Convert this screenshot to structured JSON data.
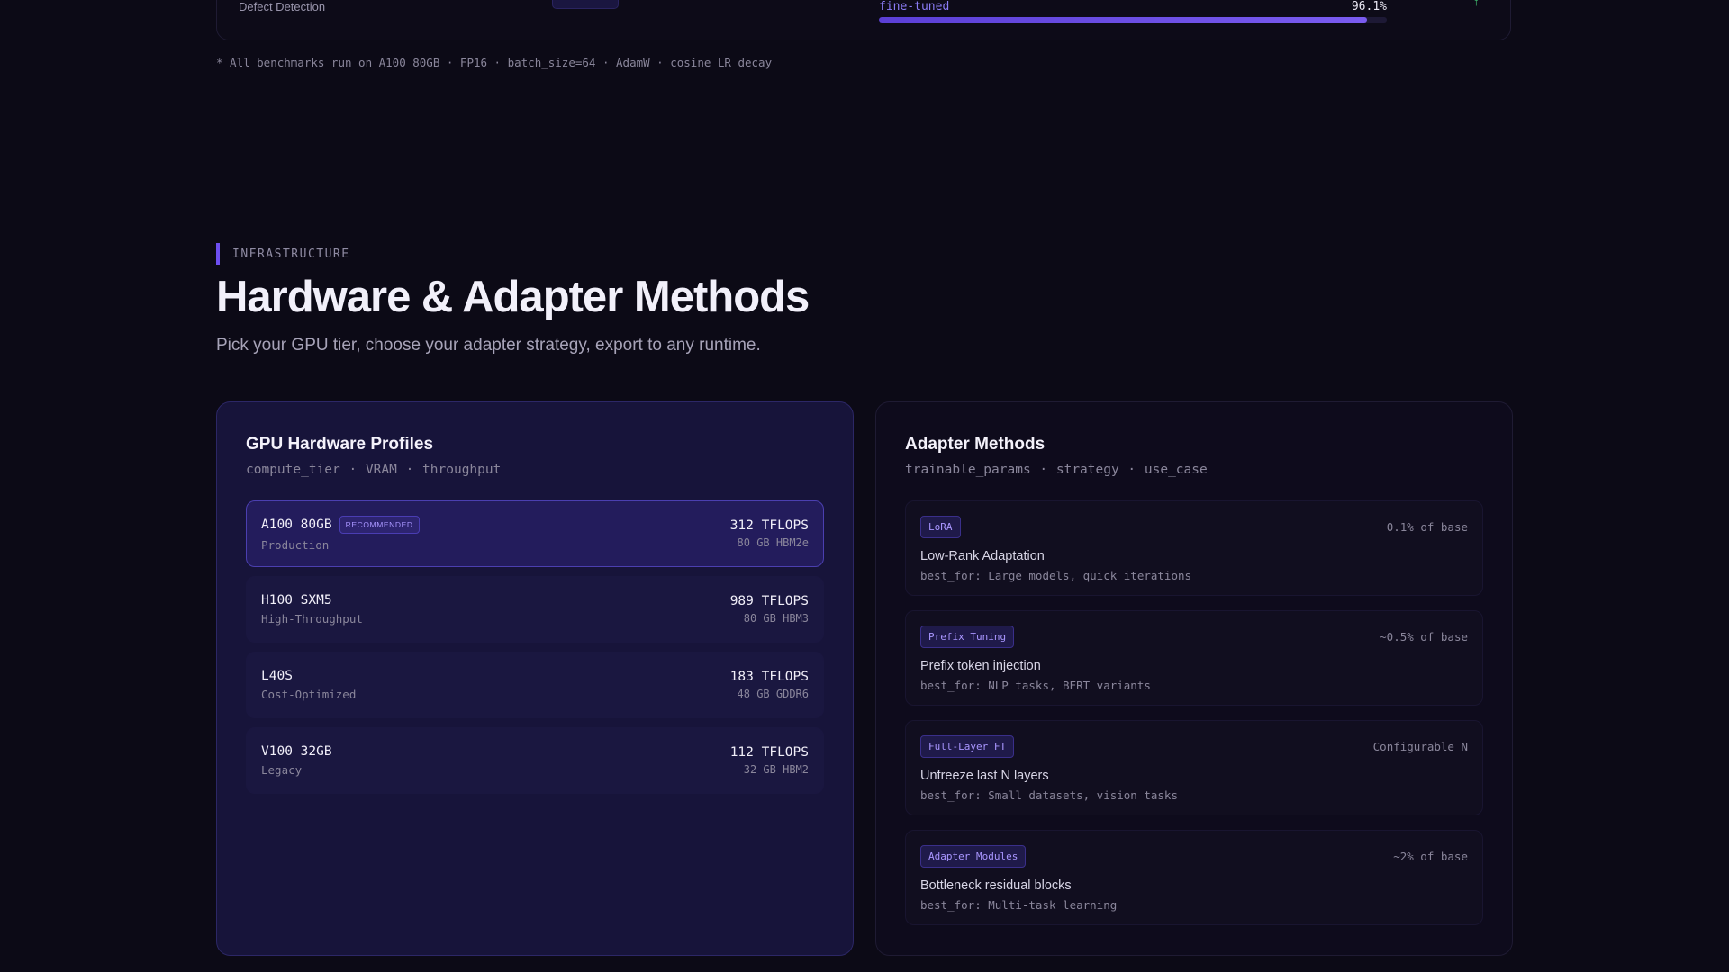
{
  "benchmark": {
    "row_label": "Defect Detection",
    "metric_label": "fine-tuned",
    "metric_value": "96.1%",
    "metric_fraction": 0.961,
    "delta_symbol": "↑",
    "footnote": "* All benchmarks run on A100 80GB · FP16 · batch_size=64 · AdamW · cosine LR decay"
  },
  "section": {
    "eyebrow": "INFRASTRUCTURE",
    "title": "Hardware & Adapter Methods",
    "subtitle": "Pick your GPU tier, choose your adapter strategy, export to any runtime."
  },
  "gpu_card": {
    "title": "GPU Hardware Profiles",
    "subtitle": "compute_tier · VRAM · throughput",
    "items": [
      {
        "name": "A100 80GB",
        "badge": "RECOMMENDED",
        "tier": "Production",
        "tflops": "312 TFLOPS",
        "memory": "80 GB HBM2e"
      },
      {
        "name": "H100 SXM5",
        "badge": "",
        "tier": "High-Throughput",
        "tflops": "989 TFLOPS",
        "memory": "80 GB HBM3"
      },
      {
        "name": "L40S",
        "badge": "",
        "tier": "Cost-Optimized",
        "tflops": "183 TFLOPS",
        "memory": "48 GB GDDR6"
      },
      {
        "name": "V100 32GB",
        "badge": "",
        "tier": "Legacy",
        "tflops": "112 TFLOPS",
        "memory": "32 GB HBM2"
      }
    ]
  },
  "adapter_card": {
    "title": "Adapter Methods",
    "subtitle": "trainable_params · strategy · use_case",
    "items": [
      {
        "tag": "LoRA",
        "params": "0.1% of base",
        "description": "Low-Rank Adaptation",
        "best_for": "best_for: Large models, quick iterations"
      },
      {
        "tag": "Prefix Tuning",
        "params": "~0.5% of base",
        "description": "Prefix token injection",
        "best_for": "best_for: NLP tasks, BERT variants"
      },
      {
        "tag": "Full-Layer FT",
        "params": "Configurable N",
        "description": "Unfreeze last N layers",
        "best_for": "best_for: Small datasets, vision tasks"
      },
      {
        "tag": "Adapter Modules",
        "params": "~2% of base",
        "description": "Bottleneck residual blocks",
        "best_for": "best_for: Multi-task learning"
      }
    ]
  },
  "colors": {
    "accent": "#6d4ef0",
    "background": "#0c0a16",
    "gpu_card_bg": "#17143a",
    "positive": "#4ade80"
  }
}
